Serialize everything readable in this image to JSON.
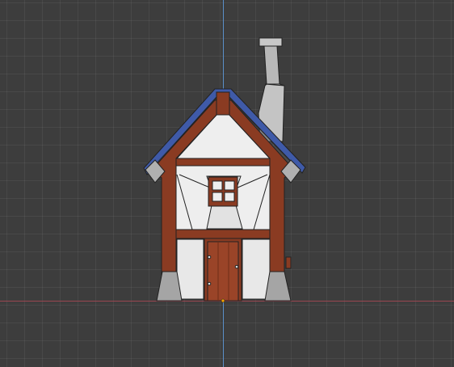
{
  "viewport": {
    "view": "front-orthographic",
    "grid": true,
    "axes": [
      "x-axis-red",
      "z-axis-blue"
    ],
    "colors": {
      "background": "#3d3d3d",
      "x_axis": "#9a4650",
      "z_axis": "#5a8fc9",
      "wall": "#eeeeee",
      "timber": "#8a3b22",
      "stone": "#a5a5a5",
      "roof_edge": "#3f5aa8",
      "chimney": "#b8b8b8"
    }
  },
  "model": {
    "object": "house",
    "parts": [
      "roof",
      "chimney",
      "walls",
      "timber-frame",
      "window",
      "door",
      "stone-foundation"
    ]
  }
}
